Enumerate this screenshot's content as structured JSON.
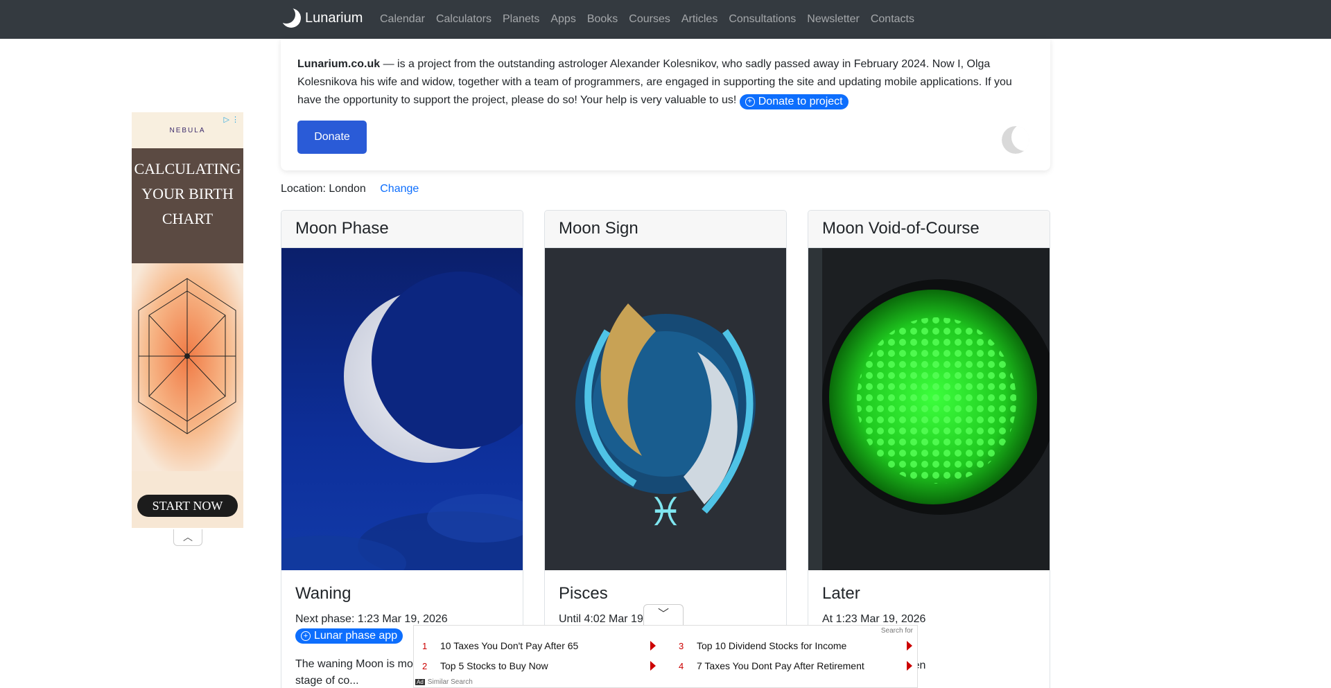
{
  "navbar": {
    "brand": "Lunarium",
    "items": [
      "Calendar",
      "Calculators",
      "Planets",
      "Apps",
      "Books",
      "Courses",
      "Articles",
      "Consultations",
      "Newsletter",
      "Contacts"
    ]
  },
  "info": {
    "site": "Lunarium.co.uk",
    "text": " — is a project from the outstanding astrologer Alexander Kolesnikov, who sadly passed away in February 2024. Now I, Olga Kolesnikova his wife and widow, together with a team of programmers, are engaged in supporting the site and updating mobile applications. If you have the opportunity to support the project, please do so! Your help is very valuable to us! ",
    "donate_project": "Donate to project",
    "donate": "Donate"
  },
  "location": {
    "label": "Location: London",
    "change": "Change"
  },
  "cards": [
    {
      "header": "Moon Phase",
      "title": "Waning",
      "sub": "Next phase: 1:23 Mar 19, 2026",
      "button": "Lunar phase app",
      "text": "The waning Moon is mo... matters at a stage of co..."
    },
    {
      "header": "Moon Sign",
      "title": "Pisces",
      "sub": "Until 4:02 Mar 19..."
    },
    {
      "header": "Moon Void-of-Course",
      "title": "Later",
      "sub": "At 1:23 Mar 19, 2026",
      "text": "...nything undertaken"
    }
  ],
  "side_ad": {
    "brand": "NEBULA",
    "headline": "CALCULATING YOUR BIRTH CHART",
    "cta": "START NOW"
  },
  "bottom_ad": {
    "search_for": "Search for",
    "items": [
      {
        "num": "1",
        "text": "10 Taxes You Don't Pay After 65"
      },
      {
        "num": "2",
        "text": "Top 5 Stocks to Buy Now"
      },
      {
        "num": "3",
        "text": "Top 10 Dividend Stocks for Income"
      },
      {
        "num": "4",
        "text": "7 Taxes You Dont Pay After Retirement"
      }
    ],
    "badge": "Ad",
    "footer": "Similar Search"
  },
  "colors": {
    "navbar": "#343a40",
    "accent": "#0d6efd",
    "donate": "#2a5bd7"
  }
}
